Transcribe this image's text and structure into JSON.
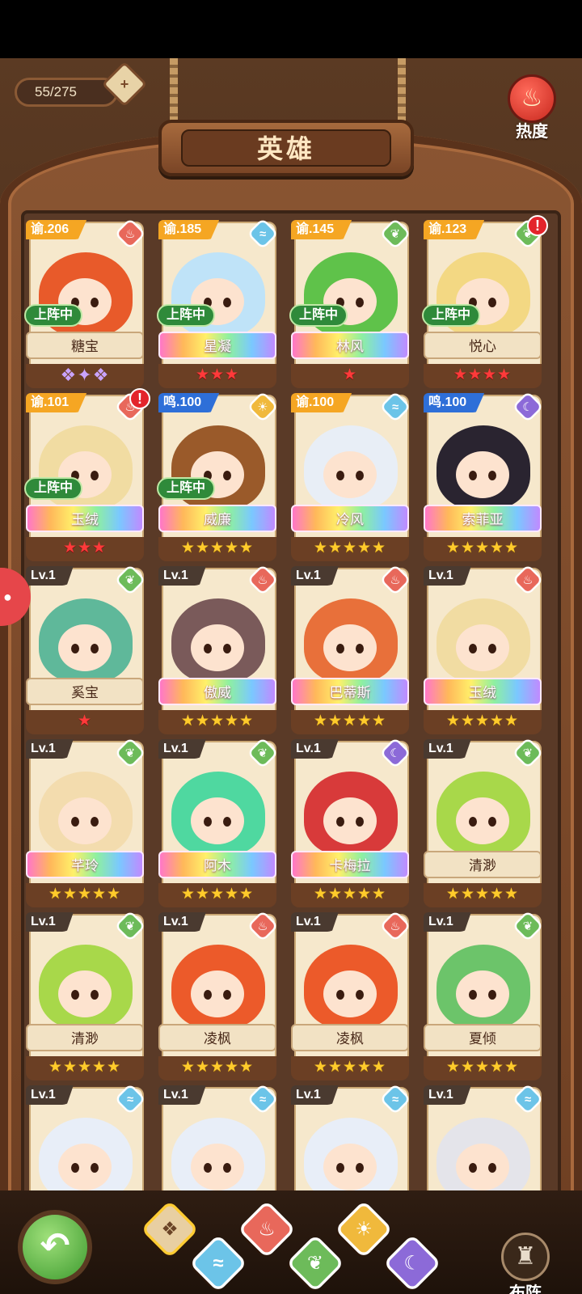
{
  "header": {
    "count": "55/275",
    "title": "英雄",
    "hot_label": "热度",
    "hot_icon": "flame-icon"
  },
  "heroes": [
    {
      "level": "谕.206",
      "level_type": "yu",
      "element": "fire",
      "name": "糖宝",
      "deployed": true,
      "deploy_label": "上阵中",
      "stars": "",
      "star_type": "wing",
      "rainbow": false,
      "alert": false,
      "hair": "#e85a2a"
    },
    {
      "level": "谕.185",
      "level_type": "yu",
      "element": "water",
      "name": "星凝",
      "deployed": true,
      "deploy_label": "上阵中",
      "stars": "★★★",
      "star_type": "red",
      "rainbow": true,
      "alert": false,
      "hair": "#bfe3f8"
    },
    {
      "level": "谕.145",
      "level_type": "yu",
      "element": "wood",
      "name": "林风",
      "deployed": true,
      "deploy_label": "上阵中",
      "stars": "★",
      "star_type": "red",
      "rainbow": true,
      "alert": false,
      "hair": "#5fc24a"
    },
    {
      "level": "谕.123",
      "level_type": "yu",
      "element": "wood",
      "name": "悦心",
      "deployed": true,
      "deploy_label": "上阵中",
      "stars": "★★★★",
      "star_type": "red",
      "rainbow": false,
      "alert": true,
      "hair": "#f3d883"
    },
    {
      "level": "谕.101",
      "level_type": "yu",
      "element": "fire",
      "name": "玉绒",
      "deployed": true,
      "deploy_label": "上阵中",
      "stars": "★★★",
      "star_type": "red",
      "rainbow": true,
      "alert": true,
      "hair": "#f1dca2"
    },
    {
      "level": "鸣.100",
      "level_type": "ming",
      "element": "light",
      "name": "威廉",
      "deployed": true,
      "deploy_label": "上阵中",
      "stars": "★★★★★",
      "star_type": "gold",
      "rainbow": true,
      "alert": false,
      "hair": "#9a5a2a"
    },
    {
      "level": "谕.100",
      "level_type": "yu",
      "element": "water",
      "name": "冷风",
      "deployed": false,
      "deploy_label": "",
      "stars": "★★★★★",
      "star_type": "gold",
      "rainbow": true,
      "alert": false,
      "hair": "#e8eef6"
    },
    {
      "level": "鸣.100",
      "level_type": "ming",
      "element": "dark",
      "name": "索菲亚",
      "deployed": false,
      "deploy_label": "",
      "stars": "★★★★★",
      "star_type": "gold",
      "rainbow": true,
      "alert": false,
      "hair": "#2a2430"
    },
    {
      "level": "Lv.1",
      "level_type": "plain",
      "element": "wood",
      "name": "奚宝",
      "deployed": false,
      "deploy_label": "",
      "stars": "★",
      "star_type": "red",
      "rainbow": false,
      "alert": false,
      "hair": "#5fb89a"
    },
    {
      "level": "Lv.1",
      "level_type": "plain",
      "element": "fire",
      "name": "傲威",
      "deployed": false,
      "deploy_label": "",
      "stars": "★★★★★",
      "star_type": "gold",
      "rainbow": true,
      "alert": false,
      "hair": "#7a5a5a"
    },
    {
      "level": "Lv.1",
      "level_type": "plain",
      "element": "fire",
      "name": "巴蒂斯",
      "deployed": false,
      "deploy_label": "",
      "stars": "★★★★★",
      "star_type": "gold",
      "rainbow": true,
      "alert": false,
      "hair": "#e8703a"
    },
    {
      "level": "Lv.1",
      "level_type": "plain",
      "element": "fire",
      "name": "玉绒",
      "deployed": false,
      "deploy_label": "",
      "stars": "★★★★★",
      "star_type": "gold",
      "rainbow": true,
      "alert": false,
      "hair": "#f1dca2"
    },
    {
      "level": "Lv.1",
      "level_type": "plain",
      "element": "wood",
      "name": "芊玲",
      "deployed": false,
      "deploy_label": "",
      "stars": "★★★★★",
      "star_type": "gold",
      "rainbow": true,
      "alert": false,
      "hair": "#f3dcae"
    },
    {
      "level": "Lv.1",
      "level_type": "plain",
      "element": "wood",
      "name": "阿木",
      "deployed": false,
      "deploy_label": "",
      "stars": "★★★★★",
      "star_type": "gold",
      "rainbow": true,
      "alert": false,
      "hair": "#4fd8a0"
    },
    {
      "level": "Lv.1",
      "level_type": "plain",
      "element": "dark",
      "name": "卡梅拉",
      "deployed": false,
      "deploy_label": "",
      "stars": "★★★★★",
      "star_type": "gold",
      "rainbow": true,
      "alert": false,
      "hair": "#d83a3a"
    },
    {
      "level": "Lv.1",
      "level_type": "plain",
      "element": "wood",
      "name": "清渺",
      "deployed": false,
      "deploy_label": "",
      "stars": "★★★★★",
      "star_type": "gold",
      "rainbow": false,
      "alert": false,
      "hair": "#a8d84a"
    },
    {
      "level": "Lv.1",
      "level_type": "plain",
      "element": "wood",
      "name": "清渺",
      "deployed": false,
      "deploy_label": "",
      "stars": "★★★★★",
      "star_type": "gold",
      "rainbow": false,
      "alert": false,
      "hair": "#a8d84a"
    },
    {
      "level": "Lv.1",
      "level_type": "plain",
      "element": "fire",
      "name": "凌枫",
      "deployed": false,
      "deploy_label": "",
      "stars": "★★★★★",
      "star_type": "gold",
      "rainbow": false,
      "alert": false,
      "hair": "#ec5a2a"
    },
    {
      "level": "Lv.1",
      "level_type": "plain",
      "element": "fire",
      "name": "凌枫",
      "deployed": false,
      "deploy_label": "",
      "stars": "★★★★★",
      "star_type": "gold",
      "rainbow": false,
      "alert": false,
      "hair": "#ec5a2a"
    },
    {
      "level": "Lv.1",
      "level_type": "plain",
      "element": "wood",
      "name": "夏倾",
      "deployed": false,
      "deploy_label": "",
      "stars": "★★★★★",
      "star_type": "gold",
      "rainbow": false,
      "alert": false,
      "hair": "#6cc46a"
    },
    {
      "level": "Lv.1",
      "level_type": "plain",
      "element": "water",
      "name": "",
      "deployed": false,
      "deploy_label": "",
      "stars": "",
      "star_type": "gold",
      "rainbow": false,
      "alert": false,
      "hair": "#e8eef8"
    },
    {
      "level": "Lv.1",
      "level_type": "plain",
      "element": "water",
      "name": "",
      "deployed": false,
      "deploy_label": "",
      "stars": "",
      "star_type": "gold",
      "rainbow": false,
      "alert": false,
      "hair": "#e8eef8"
    },
    {
      "level": "Lv.1",
      "level_type": "plain",
      "element": "water",
      "name": "",
      "deployed": false,
      "deploy_label": "",
      "stars": "",
      "star_type": "gold",
      "rainbow": false,
      "alert": false,
      "hair": "#e8eef8"
    },
    {
      "level": "Lv.1",
      "level_type": "plain",
      "element": "water",
      "name": "",
      "deployed": false,
      "deploy_label": "",
      "stars": "",
      "star_type": "gold",
      "rainbow": false,
      "alert": false,
      "hair": "#e4e4ea"
    }
  ],
  "element_glyphs": {
    "fire": "♨",
    "water": "≈",
    "wood": "❦",
    "light": "☀",
    "dark": "☾"
  },
  "bottom": {
    "back_icon": "back-arrow-icon",
    "back_glyph": "↶",
    "filters": [
      {
        "id": "all",
        "glyph": "❖"
      },
      {
        "id": "water",
        "glyph": "≈"
      },
      {
        "id": "fire",
        "glyph": "♨"
      },
      {
        "id": "wood",
        "glyph": "❦"
      },
      {
        "id": "light",
        "glyph": "☀"
      },
      {
        "id": "dark",
        "glyph": "☾"
      }
    ],
    "formation_glyph": "♜",
    "formation_label": "布阵"
  },
  "side_tab_glyph": "●"
}
